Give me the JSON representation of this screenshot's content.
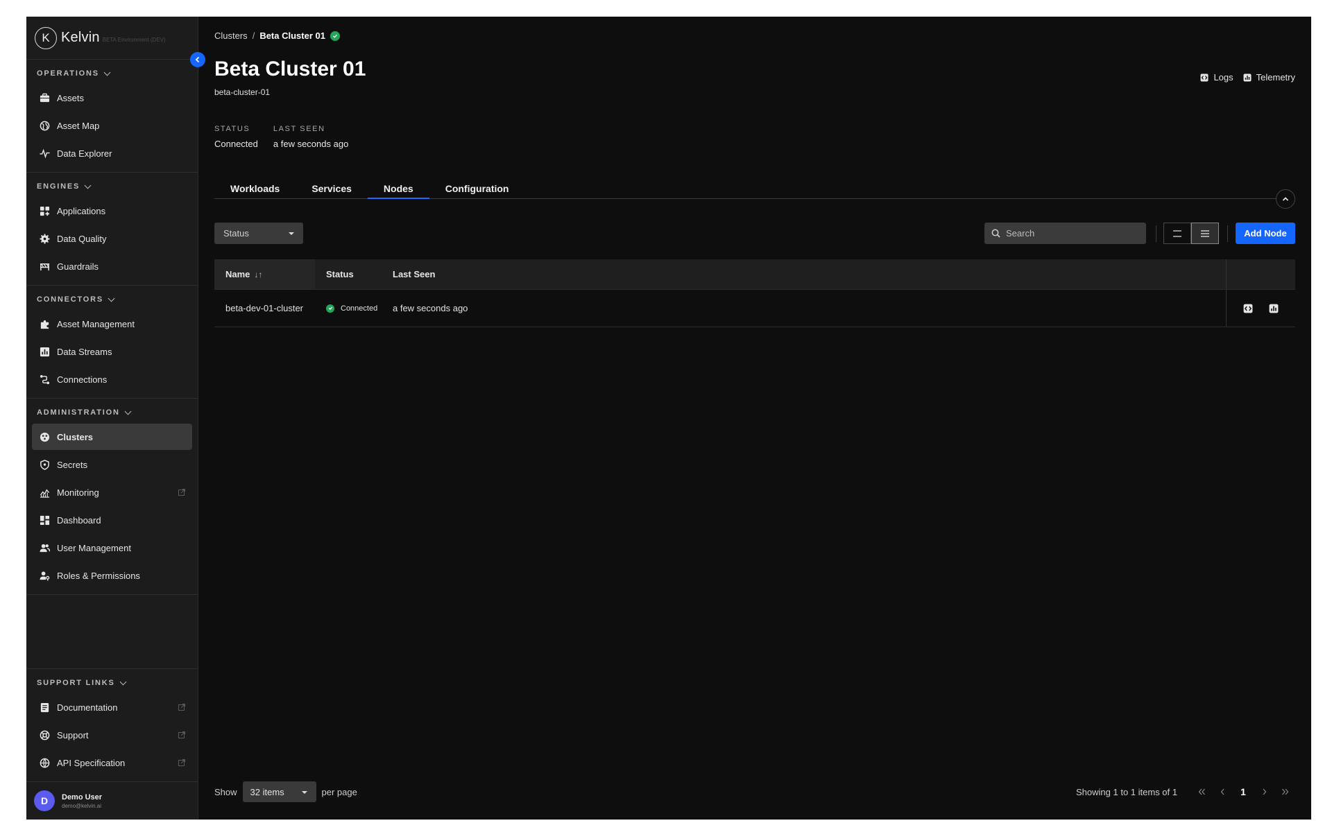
{
  "brand": {
    "name": "Kelvin",
    "logo_letter": "K",
    "env": "BETA Environment (DEV)"
  },
  "sidebar": {
    "sections": [
      {
        "title": "OPERATIONS",
        "items": [
          {
            "label": "Assets",
            "icon": "briefcase-icon"
          },
          {
            "label": "Asset Map",
            "icon": "globe-icon"
          },
          {
            "label": "Data Explorer",
            "icon": "pulse-icon"
          }
        ]
      },
      {
        "title": "ENGINES",
        "items": [
          {
            "label": "Applications",
            "icon": "apps-grid-icon"
          },
          {
            "label": "Data Quality",
            "icon": "gear-badge-icon"
          },
          {
            "label": "Guardrails",
            "icon": "guardrail-icon"
          }
        ]
      },
      {
        "title": "CONNECTORS",
        "items": [
          {
            "label": "Asset Management",
            "icon": "puzzle-icon"
          },
          {
            "label": "Data Streams",
            "icon": "bar-chart-icon"
          },
          {
            "label": "Connections",
            "icon": "connection-icon"
          }
        ]
      },
      {
        "title": "ADMINISTRATION",
        "items": [
          {
            "label": "Clusters",
            "icon": "cluster-icon",
            "active": true
          },
          {
            "label": "Secrets",
            "icon": "shield-icon"
          },
          {
            "label": "Monitoring",
            "icon": "monitoring-icon",
            "external": true
          },
          {
            "label": "Dashboard",
            "icon": "dashboard-icon"
          },
          {
            "label": "User Management",
            "icon": "users-icon"
          },
          {
            "label": "Roles & Permissions",
            "icon": "user-key-icon"
          }
        ]
      }
    ],
    "support": {
      "title": "SUPPORT LINKS",
      "items": [
        {
          "label": "Documentation",
          "icon": "document-icon",
          "external": true
        },
        {
          "label": "Support",
          "icon": "lifebuoy-icon",
          "external": true
        },
        {
          "label": "API Specification",
          "icon": "api-icon",
          "external": true
        }
      ]
    },
    "user": {
      "initial": "D",
      "name": "Demo User",
      "email": "demo@kelvin.ai"
    }
  },
  "breadcrumb": {
    "parent": "Clusters",
    "separator": "/",
    "current": "Beta Cluster 01"
  },
  "page": {
    "title": "Beta Cluster 01",
    "subtitle": "beta-cluster-01"
  },
  "top_links": {
    "logs": "Logs",
    "telemetry": "Telemetry"
  },
  "meta": {
    "status_label": "STATUS",
    "status_value": "Connected",
    "seen_label": "LAST SEEN",
    "seen_value": "a few seconds ago"
  },
  "tabs": [
    {
      "label": "Workloads"
    },
    {
      "label": "Services"
    },
    {
      "label": "Nodes",
      "active": true
    },
    {
      "label": "Configuration"
    }
  ],
  "toolbar": {
    "status_filter": "Status",
    "search_placeholder": "Search",
    "add_button": "Add Node"
  },
  "table": {
    "headers": {
      "name": "Name",
      "status": "Status",
      "seen": "Last Seen"
    },
    "rows": [
      {
        "name": "beta-dev-01-cluster",
        "status": "Connected",
        "seen": "a few seconds ago"
      }
    ]
  },
  "footer": {
    "show": "Show",
    "per_page_value": "32 items",
    "per_page": "per page",
    "showing": "Showing 1 to 1 items of 1",
    "current_page": "1"
  },
  "colors": {
    "accent": "#1566ff",
    "success": "#22a65a",
    "background": "#0e0e0e",
    "sidebar": "#1c1c1c"
  }
}
